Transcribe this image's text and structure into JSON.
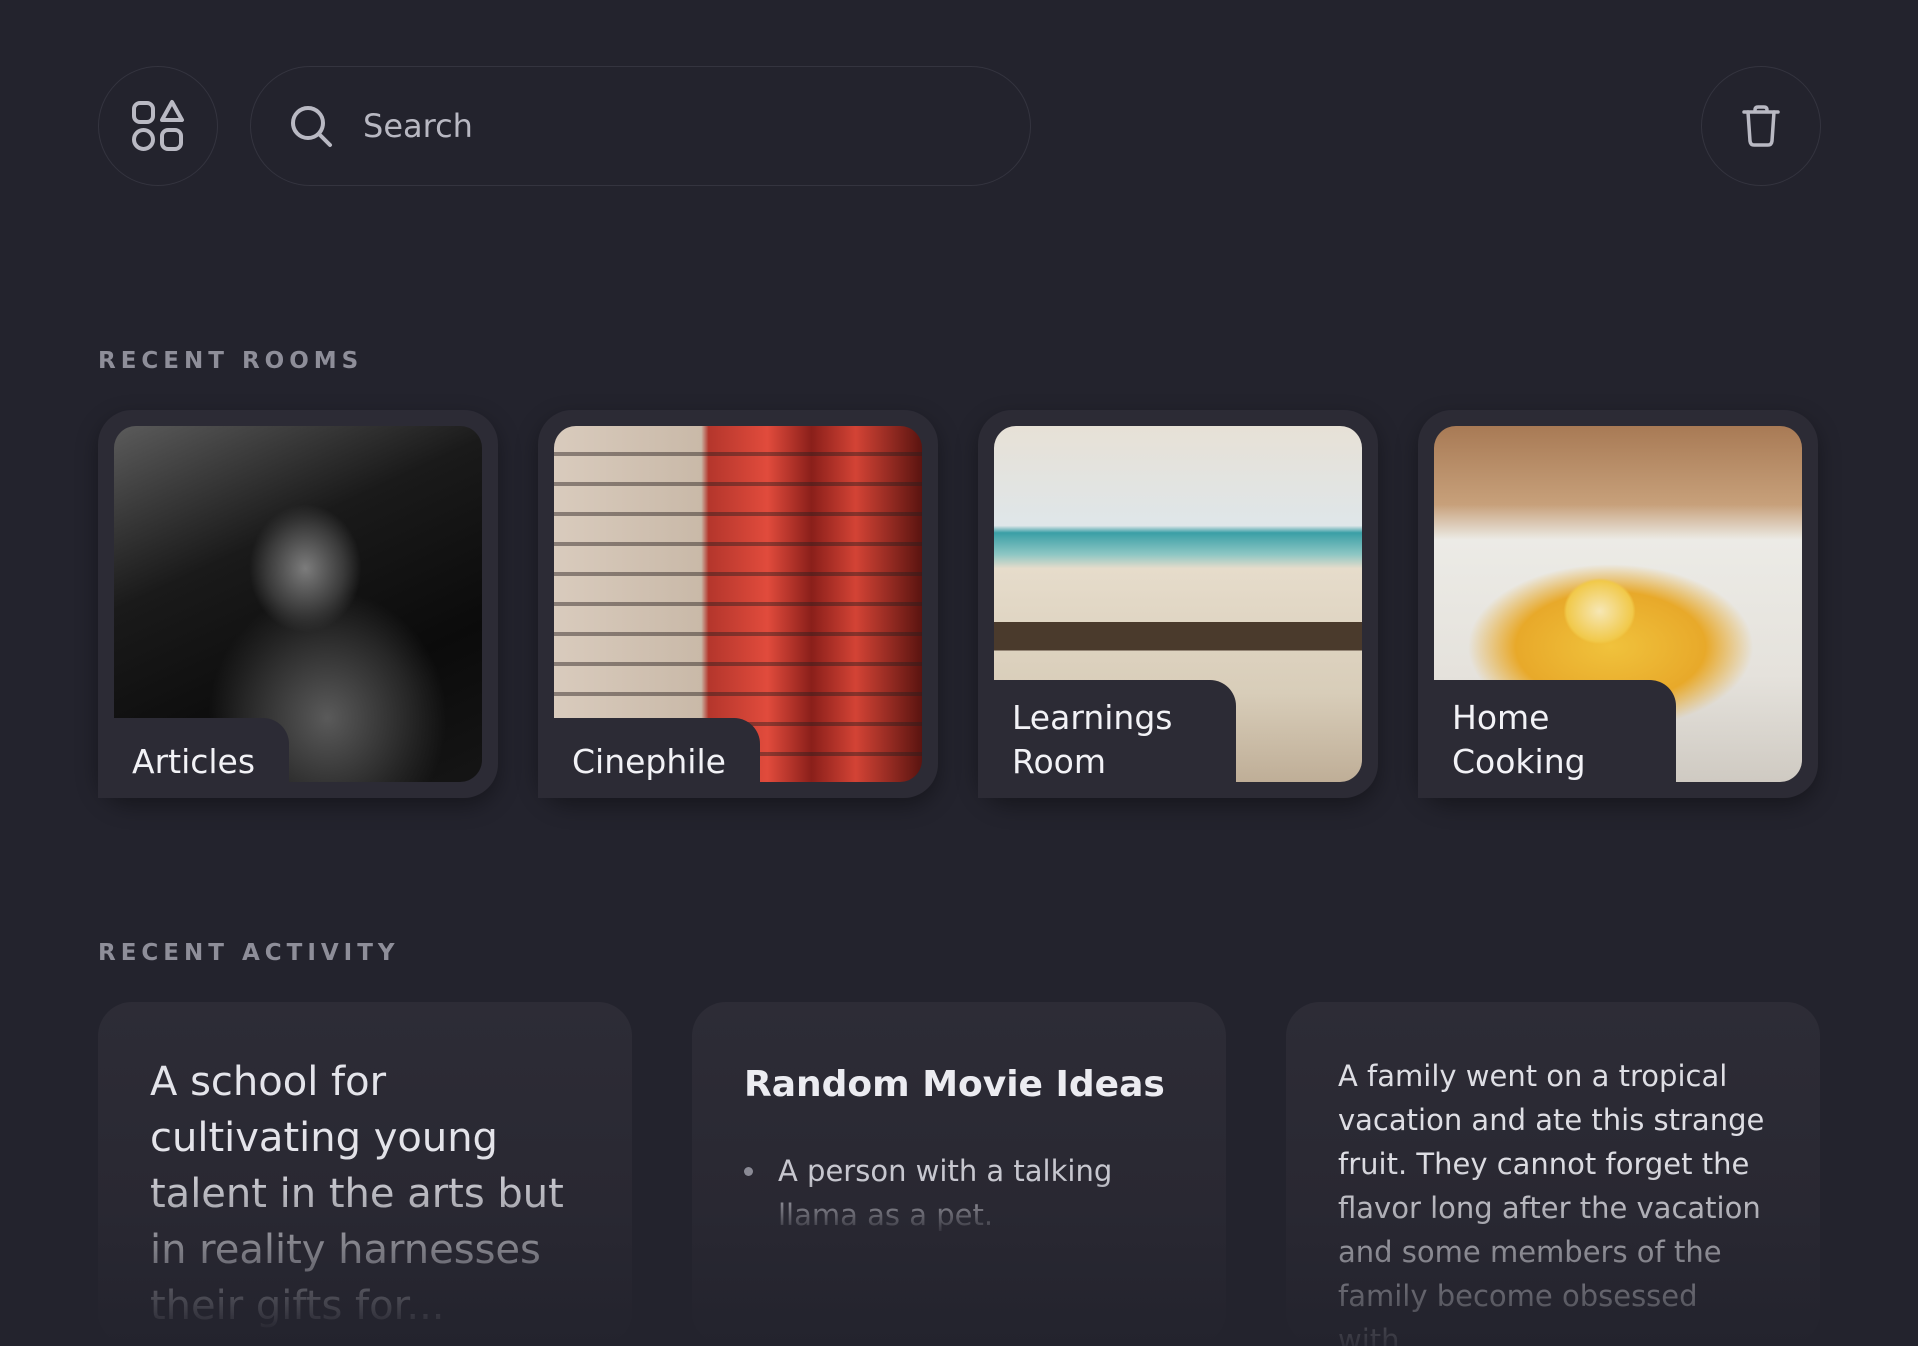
{
  "header": {
    "apps_icon": "shapes-grid-icon",
    "search_placeholder": "Search",
    "search_icon": "search-icon",
    "trash_icon": "trash-icon"
  },
  "recent_rooms": {
    "label": "RECENT ROOMS",
    "rooms": [
      {
        "label": "Articles"
      },
      {
        "label": "Cinephile"
      },
      {
        "label": "Learnings Room"
      },
      {
        "label": "Home Cooking"
      }
    ]
  },
  "recent_activity": {
    "label": "RECENT ACTIVITY",
    "cards": [
      {
        "text": "A school for cultivating young talent in the arts but in reality harnesses their gifts for..."
      },
      {
        "title": "Random Movie Ideas",
        "items": [
          "A person with a talking llama as a pet."
        ]
      },
      {
        "text": "A family went on a tropical vacation and ate this strange fruit. They cannot forget the flavor long after the vacation and some members of the family become obsessed with..."
      }
    ]
  },
  "colors": {
    "background": "#23232d",
    "card": "#2c2b35",
    "border": "#34343f",
    "muted_label": "#8e8e99"
  }
}
